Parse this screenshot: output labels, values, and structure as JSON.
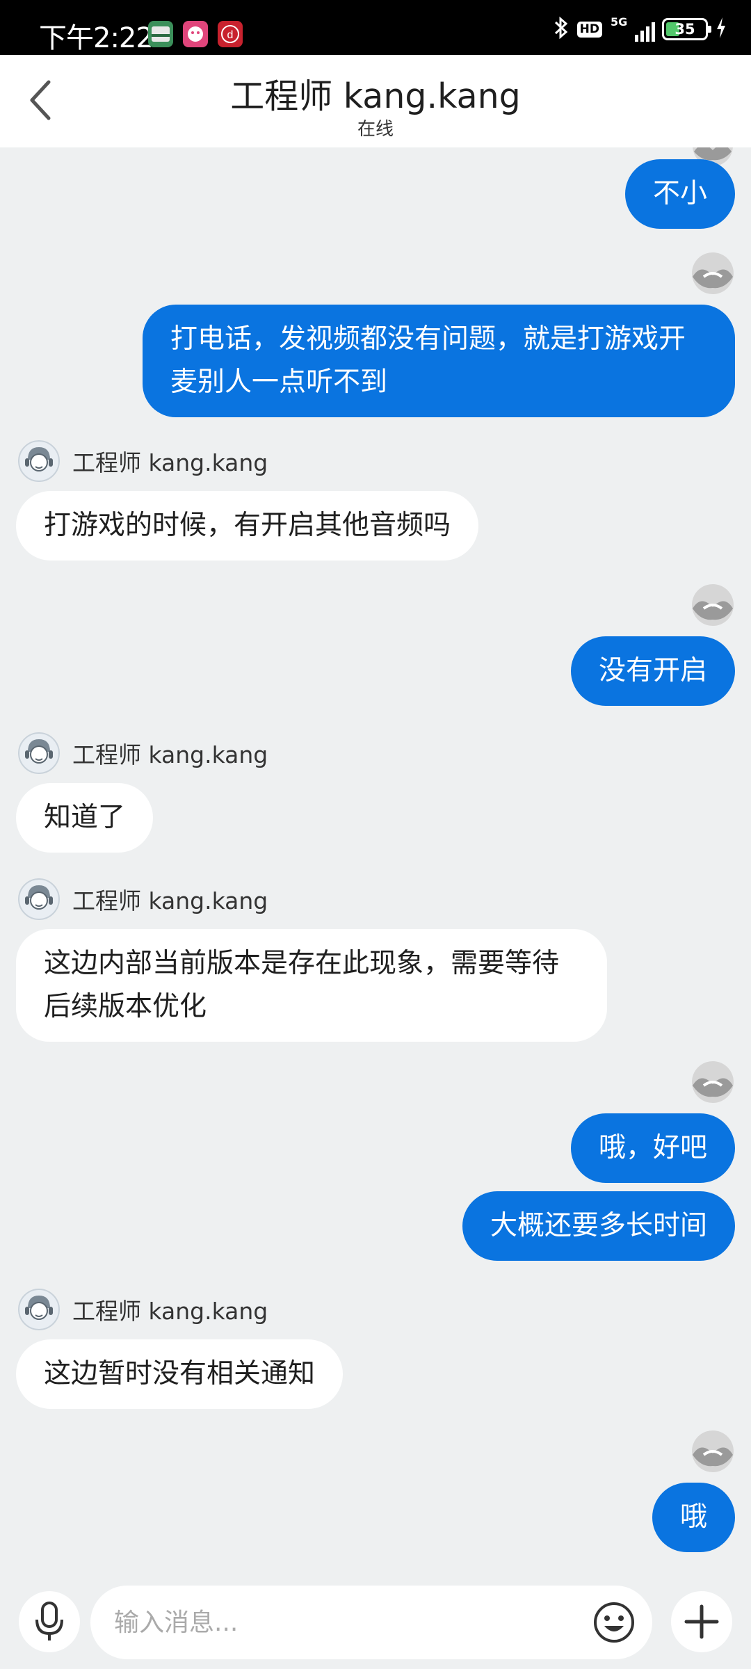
{
  "status_bar": {
    "time": "下午2:22",
    "network": "5G",
    "hd_label": "HD",
    "battery": "35",
    "battery_level_percent": 35,
    "app_icon_colors": [
      "#3b8f5a",
      "#e0457b",
      "#c8222e"
    ]
  },
  "header": {
    "back_icon": "chevron-left-icon",
    "title": "工程师 kang.kang",
    "status": "在线"
  },
  "messages": [
    {
      "direction": "out",
      "text": "不小"
    },
    {
      "direction": "out",
      "text": "打电话，发视频都没有问题，就是打游戏开麦别人一点听不到"
    },
    {
      "direction": "in",
      "sender": "工程师 kang.kang",
      "text": "打游戏的时候，有开启其他音频吗"
    },
    {
      "direction": "out",
      "text": "没有开启"
    },
    {
      "direction": "in",
      "sender": "工程师 kang.kang",
      "text": "知道了"
    },
    {
      "direction": "in",
      "sender": "工程师 kang.kang",
      "text": "这边内部当前版本是存在此现象，需要等待后续版本优化"
    },
    {
      "direction": "out",
      "text": "哦，好吧"
    },
    {
      "direction": "out",
      "text": "大概还要多长时间"
    },
    {
      "direction": "in",
      "sender": "工程师 kang.kang",
      "text": "这边暂时没有相关通知"
    },
    {
      "direction": "out",
      "text": "哦"
    }
  ],
  "input_bar": {
    "placeholder": "输入消息...",
    "mic_icon": "microphone-icon",
    "emoji_icon": "emoji-icon",
    "add_icon": "plus-icon"
  },
  "colors": {
    "accent": "#0a74e0",
    "background": "#eef0f1",
    "incoming_bubble": "#ffffff"
  }
}
